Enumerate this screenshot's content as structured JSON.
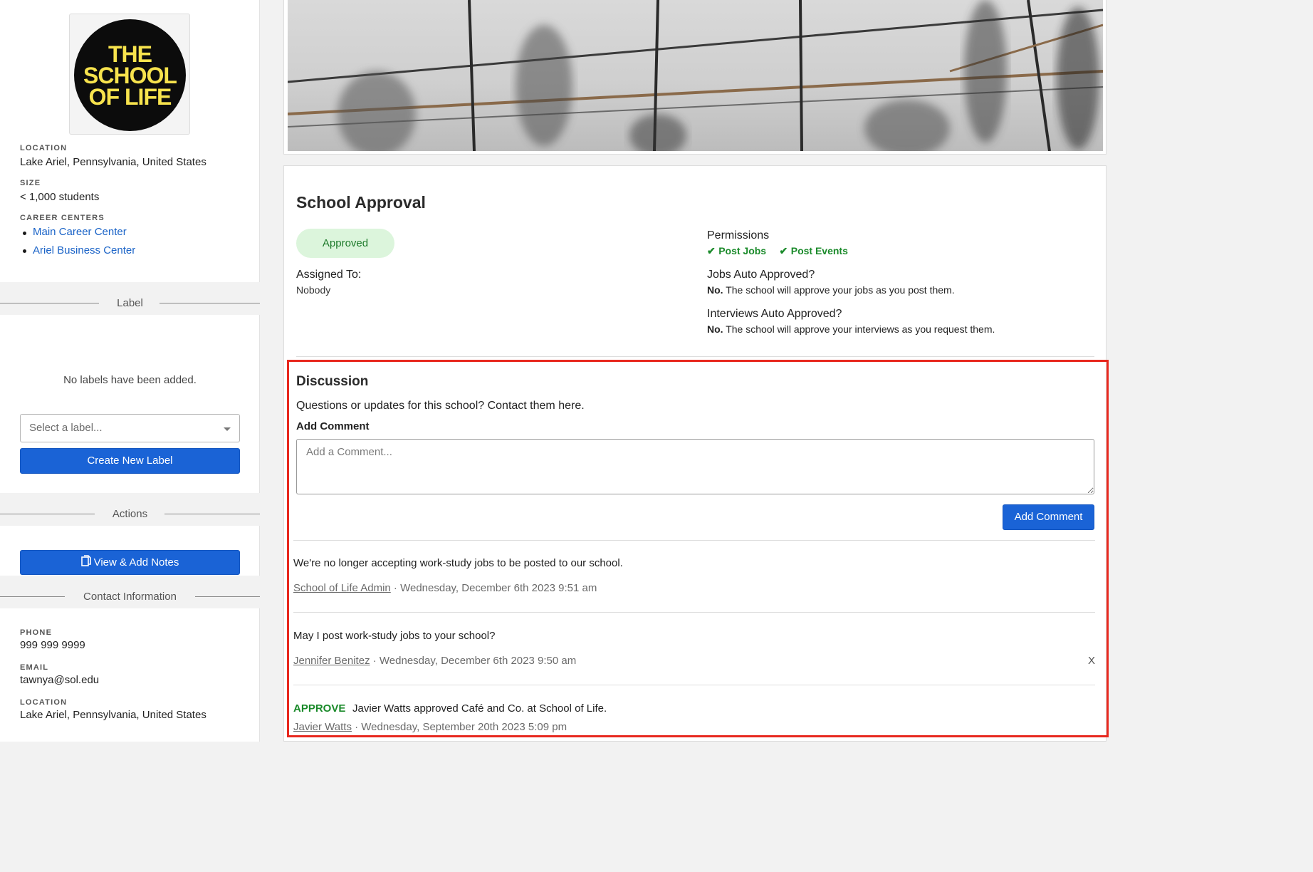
{
  "sidebar": {
    "logo_lines": [
      "THE",
      "SCHOOL",
      "OF LIFE"
    ],
    "location_label": "LOCATION",
    "location_value": "Lake Ariel, Pennsylvania, United States",
    "size_label": "SIZE",
    "size_value": "< 1,000 students",
    "career_centers_label": "CAREER CENTERS",
    "career_centers": [
      "Main Career Center",
      "Ariel Business Center"
    ],
    "label_section_title": "Label",
    "no_labels_text": "No labels have been added.",
    "select_placeholder": "Select a label...",
    "create_label_button": "Create New Label",
    "actions_title": "Actions",
    "view_notes_button": "View & Add Notes",
    "contact_title": "Contact Information",
    "phone_label": "PHONE",
    "phone_value": "999 999 9999",
    "email_label": "EMAIL",
    "email_value": "tawnya@sol.edu",
    "contact_location_label": "LOCATION",
    "contact_location_value": "Lake Ariel, Pennsylvania, United States"
  },
  "approval": {
    "title": "School Approval",
    "status": "Approved",
    "assigned_label": "Assigned To:",
    "assigned_value": "Nobody",
    "permissions_label": "Permissions",
    "permissions": [
      "Post Jobs",
      "Post Events"
    ],
    "jobs_auto_label": "Jobs Auto Approved?",
    "jobs_auto_answer": "No.",
    "jobs_auto_text": "The school will approve your jobs as you post them.",
    "interviews_auto_label": "Interviews Auto Approved?",
    "interviews_auto_answer": "No.",
    "interviews_auto_text": "The school will approve your interviews as you request them."
  },
  "discussion": {
    "title": "Discussion",
    "subtitle": "Questions or updates for this school? Contact them here.",
    "add_comment_label": "Add Comment",
    "comment_placeholder": "Add a Comment...",
    "add_comment_button": "Add Comment",
    "comments": [
      {
        "text": "We're no longer accepting work-study jobs to be posted to our school.",
        "author": "School of Life Admin",
        "date": " · Wednesday, December 6th 2023 9:51 am"
      },
      {
        "text": "May I post work-study jobs to your school?",
        "author": "Jennifer Benitez",
        "date": " · Wednesday, December 6th 2023 9:50 am",
        "delete": "X"
      },
      {
        "tag": "APPROVE",
        "text": "Javier Watts approved Café and Co. at School of Life.",
        "author": "Javier Watts",
        "date": " · Wednesday, September 20th 2023 5:09 pm"
      }
    ]
  },
  "colors": {
    "primary": "#1a63d6",
    "approved_bg": "#dcf5dc",
    "approved_text": "#1d7a2a",
    "highlight": "#e8281e"
  }
}
